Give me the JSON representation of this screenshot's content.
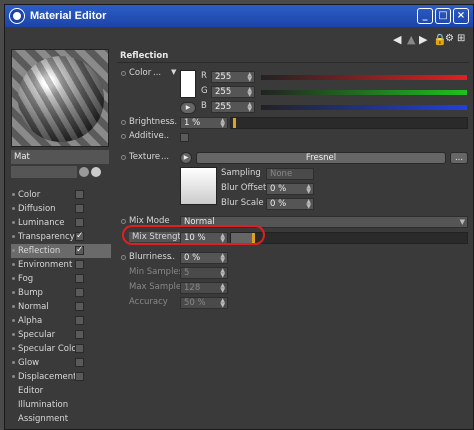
{
  "window": {
    "title": "Material Editor"
  },
  "material": {
    "name": "Mat"
  },
  "channels": [
    {
      "label": "Color",
      "checked": false,
      "has_checkbox": true,
      "selected": false
    },
    {
      "label": "Diffusion",
      "checked": false,
      "has_checkbox": true,
      "selected": false
    },
    {
      "label": "Luminance",
      "checked": false,
      "has_checkbox": true,
      "selected": false
    },
    {
      "label": "Transparency",
      "checked": true,
      "has_checkbox": true,
      "selected": false
    },
    {
      "label": "Reflection",
      "checked": true,
      "has_checkbox": true,
      "selected": true
    },
    {
      "label": "Environment",
      "checked": false,
      "has_checkbox": true,
      "selected": false
    },
    {
      "label": "Fog",
      "checked": false,
      "has_checkbox": true,
      "selected": false
    },
    {
      "label": "Bump",
      "checked": false,
      "has_checkbox": true,
      "selected": false
    },
    {
      "label": "Normal",
      "checked": false,
      "has_checkbox": true,
      "selected": false
    },
    {
      "label": "Alpha",
      "checked": false,
      "has_checkbox": true,
      "selected": false
    },
    {
      "label": "Specular",
      "checked": false,
      "has_checkbox": true,
      "selected": false
    },
    {
      "label": "Specular Color",
      "checked": false,
      "has_checkbox": true,
      "selected": false
    },
    {
      "label": "Glow",
      "checked": false,
      "has_checkbox": true,
      "selected": false
    },
    {
      "label": "Displacement",
      "checked": false,
      "has_checkbox": true,
      "selected": false
    },
    {
      "label": "Editor",
      "checked": false,
      "has_checkbox": false,
      "selected": false
    },
    {
      "label": "Illumination",
      "checked": false,
      "has_checkbox": false,
      "selected": false
    },
    {
      "label": "Assignment",
      "checked": false,
      "has_checkbox": false,
      "selected": false
    }
  ],
  "reflection": {
    "title": "Reflection",
    "color_label": "Color",
    "r_label": "R",
    "r_value": "255",
    "g_label": "G",
    "g_value": "255",
    "b_label": "B",
    "b_value": "255",
    "brightness_label": "Brightness",
    "brightness_value": "1 %",
    "additive_label": "Additive",
    "texture_label": "Texture",
    "texture_name": "Fresnel",
    "sampling_label": "Sampling",
    "sampling_value": "None",
    "blur_offset_label": "Blur Offset",
    "blur_offset_value": "0 %",
    "blur_scale_label": "Blur Scale",
    "blur_scale_value": "0 %",
    "mix_mode_label": "Mix Mode",
    "mix_mode_value": "Normal",
    "mix_strength_label": "Mix Strength",
    "mix_strength_value": "10 %",
    "blurriness_label": "Blurriness",
    "blurriness_value": "0 %",
    "min_samples_label": "Min Samples",
    "min_samples_value": "5",
    "max_samples_label": "Max Samples",
    "max_samples_value": "128",
    "accuracy_label": "Accuracy",
    "accuracy_value": "50 %",
    "ellipsis": "..."
  },
  "colors": {
    "titlebar": "#1c44a8",
    "r": "#e02020",
    "g": "#20c020",
    "b": "#2040e0",
    "highlight": "#e02020",
    "knob": "#e0a020"
  }
}
